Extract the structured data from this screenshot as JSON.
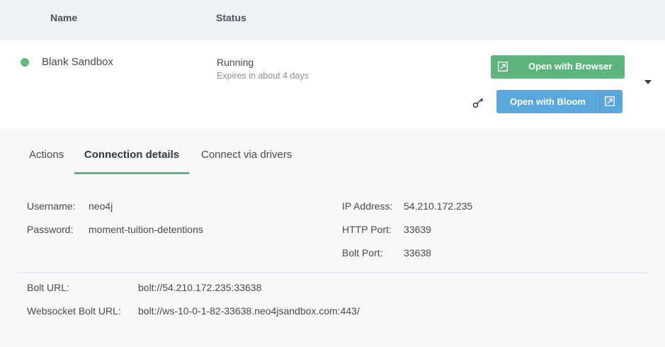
{
  "table_header": {
    "name": "Name",
    "status": "Status"
  },
  "sandbox": {
    "name": "Blank Sandbox",
    "status": "Running",
    "expires": "Expires in about 4 days",
    "status_color": "#5dba7d"
  },
  "buttons": {
    "open_browser": "Open with Browser",
    "open_bloom": "Open with Bloom",
    "browser_color": "#5db47c",
    "bloom_color": "#5aa7dc"
  },
  "icons": {
    "external_link": "external-link-icon",
    "key": "key-icon",
    "expand": "chevron-down-icon"
  },
  "tabs": [
    {
      "label": "Actions",
      "active": false
    },
    {
      "label": "Connection details",
      "active": true
    },
    {
      "label": "Connect via drivers",
      "active": false
    }
  ],
  "credentials": {
    "username_label": "Username:",
    "username": "neo4j",
    "password_label": "Password:",
    "password": "moment-tuition-detentions"
  },
  "network": {
    "ip_label": "IP Address:",
    "ip": "54.210.172.235",
    "http_label": "HTTP Port:",
    "http": "33639",
    "bolt_label": "Bolt Port:",
    "bolt": "33638"
  },
  "urls": {
    "bolt_url_label": "Bolt URL:",
    "bolt_url": "bolt://54.210.172.235:33638",
    "ws_label": "Websocket Bolt URL:",
    "ws_url": "bolt://ws-10-0-1-82-33638.neo4jsandbox.com:443/"
  }
}
